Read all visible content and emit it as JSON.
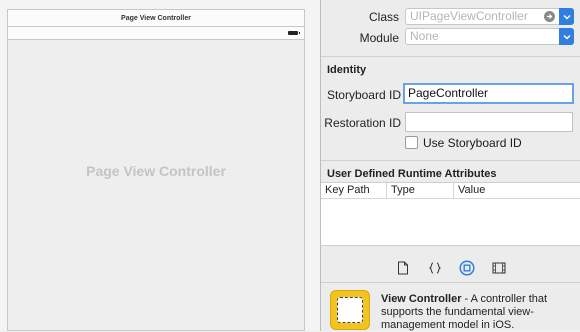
{
  "canvas": {
    "scene_title": "Page View Controller",
    "placeholder": "Page View Controller"
  },
  "custom_class": {
    "class_label": "Class",
    "class_placeholder": "UIPageViewController",
    "module_label": "Module",
    "module_placeholder": "None"
  },
  "identity": {
    "section_title": "Identity",
    "storyboard_id_label": "Storyboard ID",
    "storyboard_id_value": "PageController",
    "restoration_id_label": "Restoration ID",
    "restoration_id_value": "",
    "use_storyboard_id_label": "Use Storyboard ID"
  },
  "runtime_attributes": {
    "section_title": "User Defined Runtime Attributes",
    "columns": [
      "Key Path",
      "Type",
      "Value"
    ]
  },
  "library_tabs": [
    "file-template-icon",
    "code-snippet-icon",
    "object-library-icon",
    "media-library-icon"
  ],
  "library_item": {
    "name": "View Controller",
    "description": " - A controller that supports the fundamental view-management model in iOS."
  },
  "colors": {
    "accent": "#2f7ee0",
    "focus_ring": "#6aa2ea",
    "library_icon": "#f3c420"
  }
}
